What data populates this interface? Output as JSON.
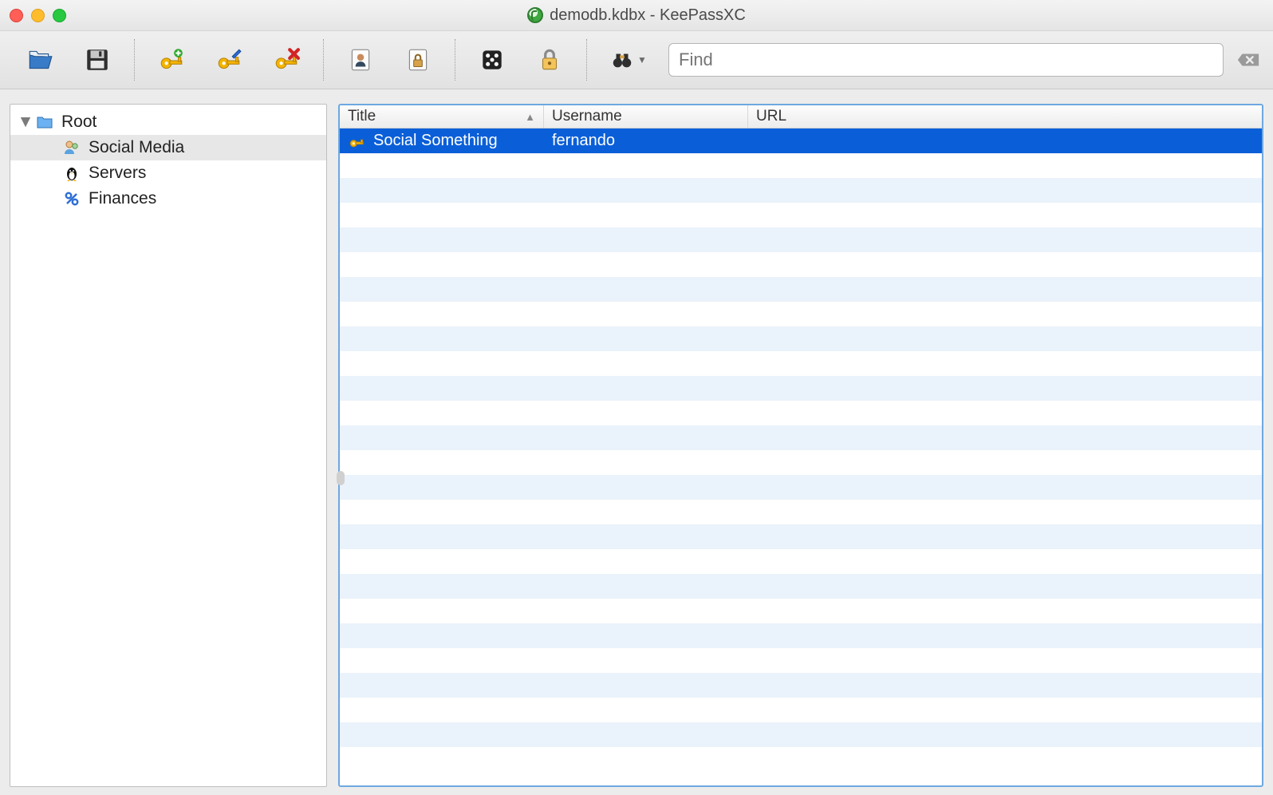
{
  "window": {
    "title": "demodb.kdbx - KeePassXC"
  },
  "toolbar": {
    "open_icon": "open-icon",
    "save_icon": "save-icon",
    "new_entry_icon": "key-plus-icon",
    "edit_entry_icon": "key-edit-icon",
    "delete_entry_icon": "key-delete-icon",
    "copy_user_icon": "copy-user-icon",
    "copy_pass_icon": "copy-password-icon",
    "generator_icon": "dice-icon",
    "lock_icon": "lock-icon",
    "search_icon": "binoculars-icon",
    "find_placeholder": "Find",
    "clear_icon": "clear-icon"
  },
  "sidebar": {
    "root_label": "Root",
    "groups": [
      {
        "label": "Social Media",
        "icon": "people-icon",
        "selected": true
      },
      {
        "label": "Servers",
        "icon": "tux-icon",
        "selected": false
      },
      {
        "label": "Finances",
        "icon": "percent-icon",
        "selected": false
      }
    ]
  },
  "table": {
    "columns": {
      "title": "Title",
      "username": "Username",
      "url": "URL"
    },
    "sort_column": "title",
    "entries": [
      {
        "title": "Social Something",
        "username": "fernando",
        "url": "",
        "selected": true
      }
    ]
  }
}
